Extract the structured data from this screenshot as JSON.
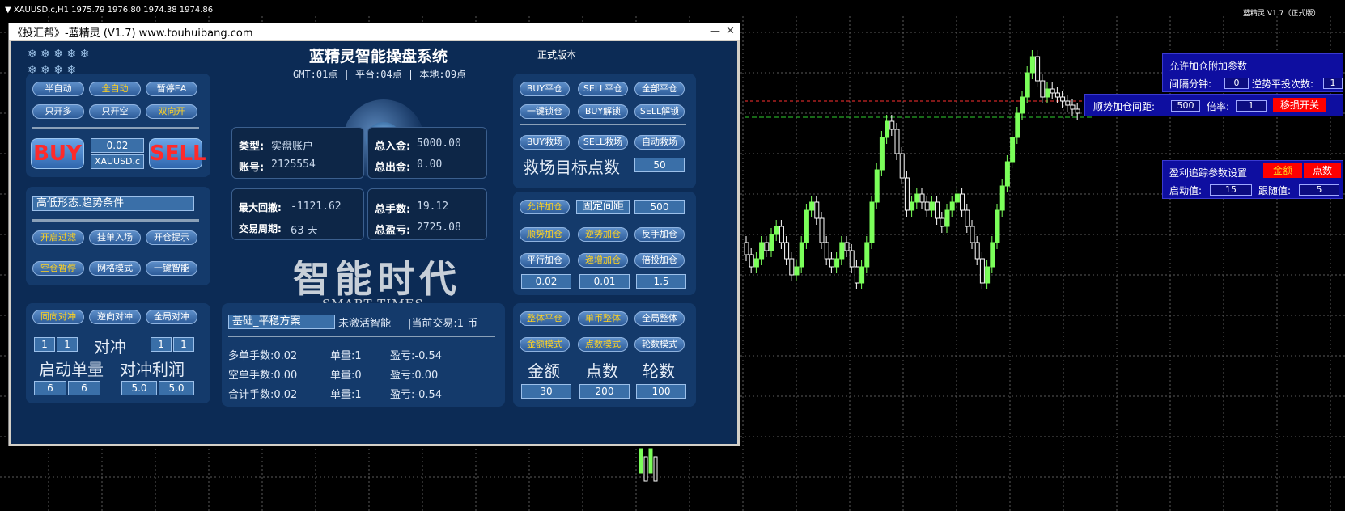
{
  "chart": {
    "header": "▼ XAUUSD.c,H1  1975.79 1976.80 1974.38 1974.86",
    "brand": "蓝精灵 V1.7（正式版）",
    "colors": {
      "grid": "#5a5a5a",
      "up": "#7bff5a",
      "down": "#ffffff"
    }
  },
  "window": {
    "title": "《投汇帮》-蓝精灵 (V1.7) www.touhuibang.com",
    "min": "—",
    "close": "✕"
  },
  "header": {
    "title": "蓝精灵智能操盘系统",
    "version": "正式版本",
    "time": "GMT:01点 | 平台:04点 | 本地:09点",
    "slogan": "智能时代",
    "slogan_en": "SMART TIMES"
  },
  "mode": {
    "semi_auto": "半自动",
    "full_auto": "全自动",
    "pause": "暂停EA",
    "long_only": "只开多",
    "short_only": "只开空",
    "both": "双向开",
    "buy": "BUY",
    "sell": "SELL",
    "lot": "0.02",
    "symbol": "XAUUSD.c"
  },
  "filter": {
    "condition": "高低形态.趋势条件",
    "open_filter": "开启过滤",
    "pending": "挂单入场",
    "prompt": "开仓提示",
    "empty_pause": "空仓暂停",
    "grid": "网格模式",
    "smart": "一键智能"
  },
  "hedge": {
    "same": "同向对冲",
    "reverse": "逆向对冲",
    "global": "全局对冲",
    "v1": "1",
    "v2": "1",
    "v3": "1",
    "v4": "1",
    "label": "对冲",
    "start_lot": "启动单量",
    "profit": "对冲利润",
    "lot1": "6",
    "lot2": "6",
    "p1": "5.0",
    "p2": "5.0"
  },
  "account": {
    "type_k": "类型:",
    "type_v": "实盘账户",
    "acct_k": "账号:",
    "acct_v": "2125554",
    "dep_k": "总入金:",
    "dep_v": "5000.00",
    "wd_k": "总出金:",
    "wd_v": "0.00",
    "dd_k": "最大回撤:",
    "dd_v": "-1121.62",
    "period_k": "交易周期:",
    "period_v": "63 天",
    "lots_k": "总手数:",
    "lots_v": "19.12",
    "profit_k": "总盈亏:",
    "profit_v": "2725.08"
  },
  "plan": {
    "name": "基础_平稳方案",
    "status": "未激活智能",
    "current": "|当前交易:1 币",
    "long_lots": "多单手数:0.02",
    "long_count": "单量:1",
    "long_pl": "盈亏:-0.54",
    "short_lots": "空单手数:0.00",
    "short_count": "单量:0",
    "short_pl": "盈亏:0.00",
    "total_lots": "合计手数:0.02",
    "total_count": "单量:1",
    "total_pl": "盈亏:-0.54"
  },
  "close": {
    "buy_close": "BUY平仓",
    "sell_close": "SELL平仓",
    "all_close": "全部平仓",
    "lock": "一键锁仓",
    "buy_unlock": "BUY解锁",
    "sell_unlock": "SELL解锁",
    "buy_rescue": "BUY救场",
    "sell_rescue": "SELL救场",
    "auto_rescue": "自动救场",
    "rescue_target": "救场目标点数",
    "rescue_value": "50"
  },
  "add": {
    "allow": "允许加仓",
    "fixed": "固定间距",
    "fixed_val": "500",
    "trend": "顺势加仓",
    "counter": "逆势加仓",
    "reverse": "反手加仓",
    "parallel": "平行加仓",
    "increment": "递增加仓",
    "multiply": "倍投加仓",
    "v1": "0.02",
    "v2": "0.01",
    "v3": "1.5"
  },
  "overall": {
    "whole_close": "整体平仓",
    "single_whole": "单币整体",
    "global_whole": "全局整体",
    "amount_mode": "金额模式",
    "point_mode": "点数模式",
    "round_mode": "轮数模式",
    "amount": "金额",
    "point": "点数",
    "round": "轮数",
    "a_val": "30",
    "p_val": "200",
    "r_val": "100"
  },
  "side_add": {
    "title": "允许加仓附加参数",
    "interval": "间隔分钟:",
    "interval_val": "0",
    "counter_times": "逆势平投次数:",
    "counter_val": "1",
    "trend_gap": "顺势加仓间距:",
    "trend_gap_val": "500",
    "rate": "倍率:",
    "rate_val": "1",
    "stop_switch": "移损开关"
  },
  "side_trail": {
    "title": "盈利追踪参数设置",
    "amount": "金额",
    "point": "点数",
    "start": "启动值:",
    "start_val": "15",
    "follow": "跟随值:",
    "follow_val": "5"
  }
}
